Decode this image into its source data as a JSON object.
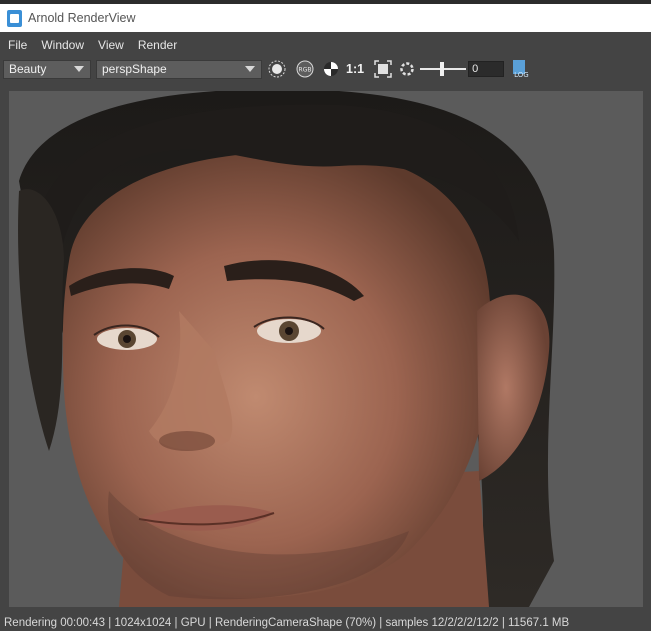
{
  "window": {
    "title": "Arnold RenderView",
    "icon": "arnold-app-icon"
  },
  "menu": [
    "File",
    "Window",
    "View",
    "Render"
  ],
  "toolbar": {
    "aov": "Beauty",
    "camera": "perspShape",
    "ratio_label": "1:1",
    "exposure_value": "0",
    "log_label": "LOG",
    "icons": [
      "sun-icon",
      "rgb-icon",
      "display-correction-icon",
      "crop-region-icon",
      "refresh-icon",
      "log-icon"
    ]
  },
  "render": {
    "subject": "rendered-face-image"
  },
  "status": {
    "text": "Rendering 00:00:43 | 1024x1024 | GPU | RenderingCameraShape (70%) | samples 12/2/2/2/12/2 | 11567.1 MB"
  }
}
